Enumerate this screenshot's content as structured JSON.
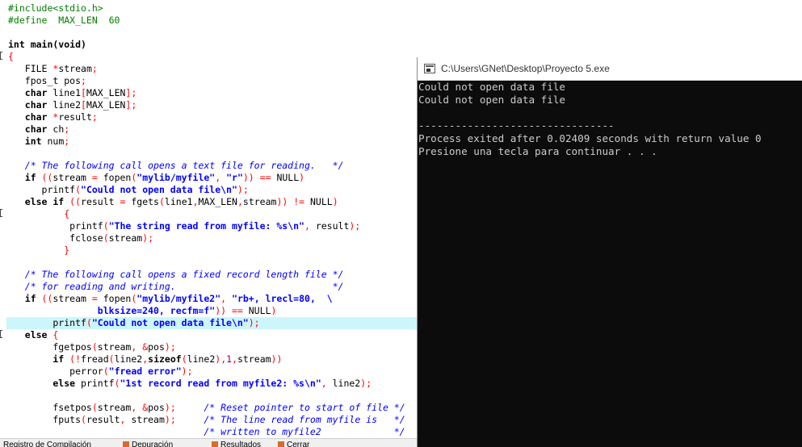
{
  "editor": {
    "lines": [
      [
        [
          "pp",
          "#include<stdio.h>"
        ]
      ],
      [
        [
          "pp",
          "#define  MAX_LEN  60"
        ]
      ],
      [],
      [
        [
          "kw",
          "int main(void)"
        ]
      ],
      [
        [
          "op",
          "{"
        ]
      ],
      [
        [
          "tx",
          "   FILE "
        ],
        [
          "op",
          "*"
        ],
        [
          "tx",
          "stream"
        ],
        [
          "op",
          ";"
        ]
      ],
      [
        [
          "tx",
          "   fpos_t pos"
        ],
        [
          "op",
          ";"
        ]
      ],
      [
        [
          "kw",
          "   char "
        ],
        [
          "tx",
          "line1"
        ],
        [
          "op",
          "["
        ],
        [
          "tx",
          "MAX_LEN"
        ],
        [
          "op",
          "];"
        ]
      ],
      [
        [
          "kw",
          "   char "
        ],
        [
          "tx",
          "line2"
        ],
        [
          "op",
          "["
        ],
        [
          "tx",
          "MAX_LEN"
        ],
        [
          "op",
          "];"
        ]
      ],
      [
        [
          "kw",
          "   char "
        ],
        [
          "op",
          "*"
        ],
        [
          "tx",
          "result"
        ],
        [
          "op",
          ";"
        ]
      ],
      [
        [
          "kw",
          "   char "
        ],
        [
          "tx",
          "ch"
        ],
        [
          "op",
          ";"
        ]
      ],
      [
        [
          "kw",
          "   int "
        ],
        [
          "tx",
          "num"
        ],
        [
          "op",
          ";"
        ]
      ],
      [],
      [
        [
          "cm",
          "   /* The following call opens a text file for reading.   */"
        ]
      ],
      [
        [
          "kw",
          "   if "
        ],
        [
          "op",
          "(("
        ],
        [
          "tx",
          "stream "
        ],
        [
          "op",
          "="
        ],
        [
          "tx",
          " fopen"
        ],
        [
          "op",
          "("
        ],
        [
          "str",
          "\"mylib/myfile\""
        ],
        [
          "op",
          ", "
        ],
        [
          "str",
          "\"r\""
        ],
        [
          "op",
          "))"
        ],
        [
          "op",
          " =="
        ],
        [
          "tx",
          " NULL"
        ],
        [
          "op",
          ")"
        ]
      ],
      [
        [
          "tx",
          "      printf"
        ],
        [
          "op",
          "("
        ],
        [
          "str",
          "\"Could not open data file\\n\""
        ],
        [
          "op",
          ");"
        ]
      ],
      [
        [
          "kw",
          "   else if "
        ],
        [
          "op",
          "(("
        ],
        [
          "tx",
          "result "
        ],
        [
          "op",
          "="
        ],
        [
          "tx",
          " fgets"
        ],
        [
          "op",
          "("
        ],
        [
          "tx",
          "line1"
        ],
        [
          "op",
          ","
        ],
        [
          "tx",
          "MAX_LEN"
        ],
        [
          "op",
          ","
        ],
        [
          "tx",
          "stream"
        ],
        [
          "op",
          "))"
        ],
        [
          "op",
          " !="
        ],
        [
          "tx",
          " NULL"
        ],
        [
          "op",
          ")"
        ]
      ],
      [
        [
          "op",
          "          {"
        ]
      ],
      [
        [
          "tx",
          "           printf"
        ],
        [
          "op",
          "("
        ],
        [
          "str",
          "\"The string read from myfile: %s\\n\""
        ],
        [
          "op",
          ", "
        ],
        [
          "tx",
          "result"
        ],
        [
          "op",
          ");"
        ]
      ],
      [
        [
          "tx",
          "           fclose"
        ],
        [
          "op",
          "("
        ],
        [
          "tx",
          "stream"
        ],
        [
          "op",
          ");"
        ]
      ],
      [
        [
          "op",
          "          }"
        ]
      ],
      [],
      [
        [
          "cm",
          "   /* The following call opens a fixed record length file */"
        ]
      ],
      [
        [
          "cm",
          "   /* for reading and writing.                            */"
        ]
      ],
      [
        [
          "kw",
          "   if "
        ],
        [
          "op",
          "(("
        ],
        [
          "tx",
          "stream "
        ],
        [
          "op",
          "="
        ],
        [
          "tx",
          " fopen"
        ],
        [
          "op",
          "("
        ],
        [
          "str",
          "\"mylib/myfile2\""
        ],
        [
          "op",
          ", "
        ],
        [
          "str",
          "\"rb+, lrecl=80,  \\"
        ]
      ],
      [
        [
          "str",
          "                blksize=240, recfm=f\""
        ],
        [
          "op",
          "))"
        ],
        [
          "op",
          " =="
        ],
        [
          "tx",
          " NULL"
        ],
        [
          "op",
          ")"
        ]
      ],
      [
        [
          "tx",
          "        printf"
        ],
        [
          "op",
          "("
        ],
        [
          "str",
          "\"Could not open data file\\n\""
        ],
        [
          "op",
          ");"
        ]
      ],
      [
        [
          "kw",
          "   else "
        ],
        [
          "op",
          "{"
        ]
      ],
      [
        [
          "tx",
          "        fgetpos"
        ],
        [
          "op",
          "("
        ],
        [
          "tx",
          "stream"
        ],
        [
          "op",
          ", &"
        ],
        [
          "tx",
          "pos"
        ],
        [
          "op",
          ");"
        ]
      ],
      [
        [
          "kw",
          "        if "
        ],
        [
          "op",
          "(!"
        ],
        [
          "tx",
          "fread"
        ],
        [
          "op",
          "("
        ],
        [
          "tx",
          "line2"
        ],
        [
          "op",
          ","
        ],
        [
          "kw",
          "sizeof"
        ],
        [
          "op",
          "("
        ],
        [
          "tx",
          "line2"
        ],
        [
          "op",
          "),"
        ],
        [
          "num",
          "1"
        ],
        [
          "op",
          ","
        ],
        [
          "tx",
          "stream"
        ],
        [
          "op",
          "))"
        ]
      ],
      [
        [
          "tx",
          "           perror"
        ],
        [
          "op",
          "("
        ],
        [
          "str",
          "\"fread error\""
        ],
        [
          "op",
          ");"
        ]
      ],
      [
        [
          "kw",
          "        else "
        ],
        [
          "tx",
          "printf"
        ],
        [
          "op",
          "("
        ],
        [
          "str",
          "\"1st record read from myfile2: %s\\n\""
        ],
        [
          "op",
          ", "
        ],
        [
          "tx",
          "line2"
        ],
        [
          "op",
          ");"
        ]
      ],
      [],
      [
        [
          "tx",
          "        fsetpos"
        ],
        [
          "op",
          "("
        ],
        [
          "tx",
          "stream"
        ],
        [
          "op",
          ", &"
        ],
        [
          "tx",
          "pos"
        ],
        [
          "op",
          ");"
        ],
        [
          "cm",
          "     /* Reset pointer to start of file */"
        ]
      ],
      [
        [
          "tx",
          "        fputs"
        ],
        [
          "op",
          "("
        ],
        [
          "tx",
          "result"
        ],
        [
          "op",
          ", "
        ],
        [
          "tx",
          "stream"
        ],
        [
          "op",
          ");"
        ],
        [
          "cm",
          "     /* The line read from myfile is   */"
        ]
      ],
      [
        [
          "cm",
          "                                   /* written to myfile2             */"
        ]
      ]
    ],
    "highlight_line": 26,
    "bottom_tabs": [
      "Registro de Compilación",
      "Depuración",
      "Resultados",
      "Cerrar"
    ]
  },
  "console": {
    "title": "C:\\Users\\GNet\\Desktop\\Proyecto 5.exe",
    "lines": [
      "Could not open data file",
      "Could not open data file",
      "",
      "--------------------------------",
      "Process exited after 0.02409 seconds with return value 0",
      "Presione una tecla para continuar . . ."
    ]
  }
}
